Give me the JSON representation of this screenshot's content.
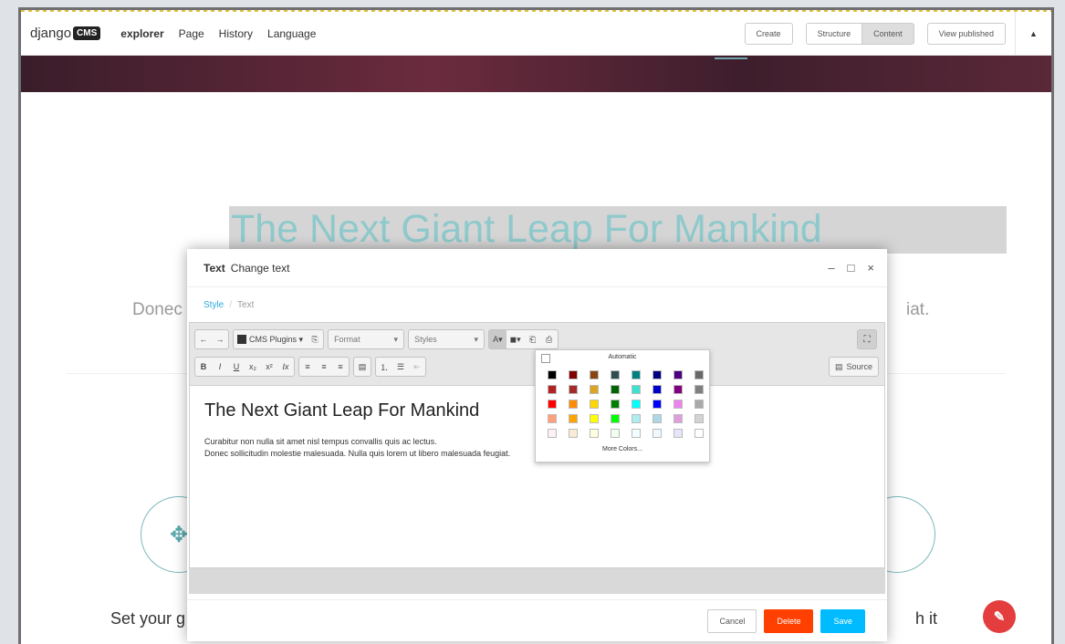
{
  "toolbar": {
    "logo_text": "django",
    "logo_badge": "CMS",
    "nav": [
      "explorer",
      "Page",
      "History",
      "Language"
    ],
    "create": "Create",
    "structure": "Structure",
    "content": "Content",
    "view_published": "View published",
    "collapse_icon": "▲"
  },
  "page": {
    "headline": "The Next Giant Leap For Mankind",
    "subtitle_left": "Donec s",
    "subtitle_right": "iat.",
    "goal_left": "Set your g",
    "goal_right": "h it",
    "left_circle_icon": "move-arrows-icon",
    "fab_icon": "edit-icon"
  },
  "modal": {
    "title": "Text",
    "subtitle": "Change text",
    "breadcrumb": [
      "Style",
      "Text"
    ],
    "controls": [
      "–",
      "□",
      "×"
    ],
    "toolbar": {
      "plugins": "CMS Plugins",
      "format": "Format",
      "styles": "Styles",
      "source": "Source",
      "format_buttons": [
        "B",
        "I",
        "U",
        "x₂",
        "x²",
        "Ix"
      ]
    },
    "editor_heading": "The Next Giant Leap For Mankind",
    "editor_lines": [
      "Curabitur non nulla sit amet nisl tempus convallis quis ac lectus.",
      "Donec sollicitudin molestie malesuada. Nulla quis lorem ut libero malesuada feugiat."
    ],
    "cancel": "Cancel",
    "delete": "Delete",
    "save": "Save"
  },
  "color_panel": {
    "automatic": "Automatic",
    "more": "More Colors...",
    "colors": [
      "#000000",
      "#800000",
      "#8b4513",
      "#2f4f4f",
      "#008080",
      "#000080",
      "#4b0082",
      "#696969",
      "#b22222",
      "#a52a2a",
      "#daa520",
      "#006400",
      "#40e0d0",
      "#0000cd",
      "#800080",
      "#808080",
      "#ff0000",
      "#ff8c00",
      "#ffd700",
      "#008000",
      "#00ffff",
      "#0000ff",
      "#ee82ee",
      "#a9a9a9",
      "#ffa07a",
      "#ffa500",
      "#ffff00",
      "#00ff00",
      "#afeeee",
      "#add8e6",
      "#dda0dd",
      "#d3d3d3",
      "#fff0f5",
      "#faebd7",
      "#ffffe0",
      "#f0fff0",
      "#f0ffff",
      "#f0f8ff",
      "#e6e6fa",
      "#ffffff"
    ]
  },
  "colors": {
    "accent": "#2aa8df",
    "headline": "#8ec9cb",
    "delete": "#ff4000",
    "save": "#00bbff",
    "fab": "#e33d3d"
  }
}
